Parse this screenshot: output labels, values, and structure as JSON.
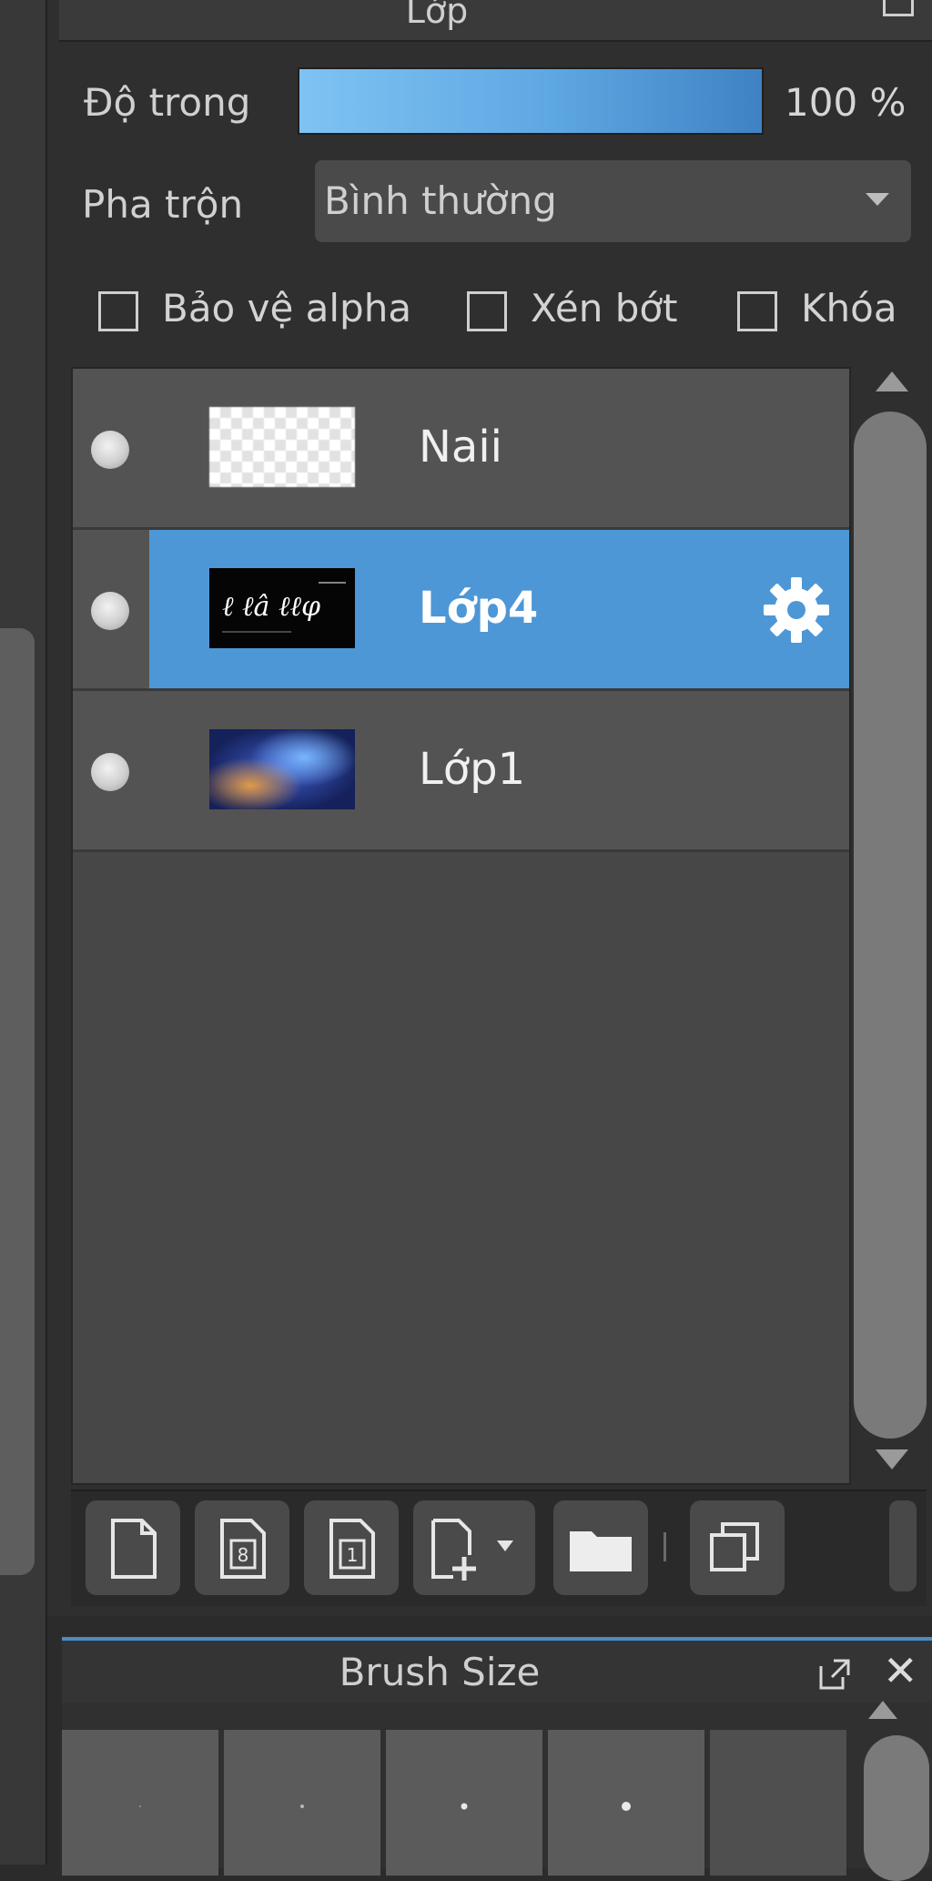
{
  "panel": {
    "title": "Lớp",
    "opacity_label": "Độ trong",
    "opacity_value_text": "100 %",
    "opacity_percent": 100,
    "blend_label": "Pha trộn",
    "blend_value": "Bình thường",
    "checkboxes": [
      {
        "label": "Bảo vệ alpha",
        "checked": false
      },
      {
        "label": "Xén bớt",
        "checked": false
      },
      {
        "label": "Khóa",
        "checked": false
      }
    ]
  },
  "layers": [
    {
      "name": "Naii",
      "selected": false,
      "thumbnail": "transparent-checkerboard"
    },
    {
      "name": "Lớp4",
      "selected": true,
      "thumbnail": "black-with-white-text",
      "settings_icon": "gear-icon"
    },
    {
      "name": "Lớp1",
      "selected": false,
      "thumbnail": "galaxy-image"
    }
  ],
  "toolbar": {
    "buttons": [
      {
        "icon": "new-layer-icon"
      },
      {
        "icon": "new-8bit-layer-icon"
      },
      {
        "icon": "new-1bit-layer-icon"
      },
      {
        "icon": "add-layer-dropdown-icon"
      },
      {
        "icon": "folder-icon"
      },
      {
        "icon": "duplicate-layer-icon"
      }
    ]
  },
  "brush_panel": {
    "title": "Brush Size"
  },
  "colors": {
    "accent": "#4e97d6",
    "panel_bg": "#2f2f2f",
    "list_bg": "#474747"
  }
}
